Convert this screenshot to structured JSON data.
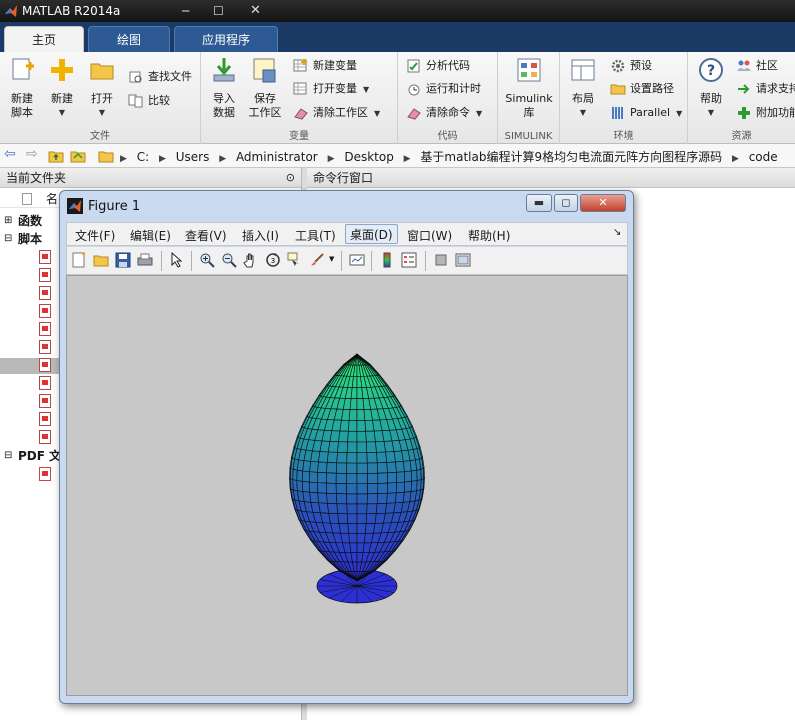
{
  "window": {
    "title": "MATLAB R2014a"
  },
  "ribbon_tabs": [
    {
      "label": "主页",
      "active": true
    },
    {
      "label": "绘图",
      "active": false
    },
    {
      "label": "应用程序",
      "active": false
    }
  ],
  "ribbon": {
    "file_group": {
      "label": "文件",
      "new_script": "新建\n脚本",
      "new": "新建",
      "open": "打开",
      "find_files": "查找文件",
      "compare": "比较"
    },
    "variable_group": {
      "label": "变量",
      "import": "导入\n数据",
      "save_ws": "保存\n工作区",
      "new_var": "新建变量",
      "open_var": "打开变量",
      "clear_ws": "清除工作区"
    },
    "code_group": {
      "label": "代码",
      "analyze": "分析代码",
      "run_time": "运行和计时",
      "clear_cmd": "清除命令"
    },
    "simulink_group": {
      "label": "SIMULINK",
      "simulink": "Simulink\n库"
    },
    "env_group": {
      "label": "环境",
      "layout": "布局",
      "prefs": "预设",
      "set_path": "设置路径",
      "parallel": "Parallel"
    },
    "resources_group": {
      "label": "资源",
      "help": "帮助",
      "community": "社区",
      "request_support": "请求支持",
      "addons": "附加功能"
    }
  },
  "address": {
    "crumbs": [
      "C:",
      "Users",
      "Administrator",
      "Desktop",
      "基于matlab编程计算9格均匀电流面元阵方向图程序源码",
      "code"
    ]
  },
  "current_folder": {
    "title": "当前文件夹",
    "col_name": "名",
    "sections": [
      {
        "label": "函数",
        "expanded": false
      },
      {
        "label": "脚本",
        "expanded": true
      },
      {
        "label": "PDF 文",
        "expanded": true
      }
    ]
  },
  "command_window": {
    "title": "命令行窗口"
  },
  "figure": {
    "title": "Figure 1",
    "menu": [
      "文件(F)",
      "编辑(E)",
      "查看(V)",
      "插入(I)",
      "工具(T)",
      "桌面(D)",
      "窗口(W)",
      "帮助(H)"
    ],
    "active_menu": "桌面(D)",
    "plot": {
      "type": "3d-surface",
      "shape": "radiation-pattern-lobe",
      "colormap": [
        "#2be67a",
        "#23a3a0",
        "#2a53b8",
        "#2c2fd4"
      ],
      "background": "#c8c8c8"
    }
  },
  "colors": {
    "tab_bar": "#1b3b66",
    "ribbon_bg": "#f3f3f3",
    "figure_frame": "#c9daf0"
  }
}
